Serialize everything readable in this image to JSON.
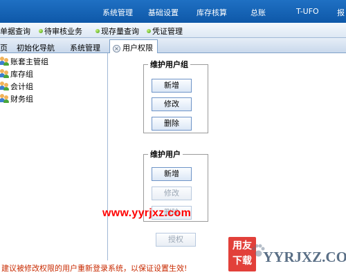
{
  "top_menu": {
    "items": [
      "系统管理",
      "基础设置",
      "库存核算",
      "总账",
      "T-UFO",
      "报"
    ]
  },
  "toolbar": {
    "items": [
      "单据查询",
      "待审核业务",
      "现存量查询",
      "凭证管理"
    ]
  },
  "tabs": {
    "items": [
      "页",
      "初始化导航",
      "系统管理"
    ],
    "active": "用户权限"
  },
  "tree": {
    "items": [
      "账套主管组",
      "库存组",
      "会计组",
      "财务组"
    ]
  },
  "user_group": {
    "legend": "维护用户组",
    "add": "新增",
    "edit": "修改",
    "delete": "删除"
  },
  "user": {
    "legend": "维护用户",
    "add": "新增",
    "edit": "修改",
    "delete": "删除"
  },
  "authorize_label": "授权",
  "status": {
    "message": "建议被修改权限的用户重新登录系统，以保证设置生效!"
  },
  "watermark": {
    "url": "www.yyrjxz.com",
    "logo_cn": "用友下载",
    "logo_en": "YYRJXZ.COM"
  },
  "colors": {
    "menu_bar": "#1a66b8",
    "status_text": "#c82a00",
    "watermark_red": "#ff0000",
    "logo_bg": "#e2403a"
  }
}
